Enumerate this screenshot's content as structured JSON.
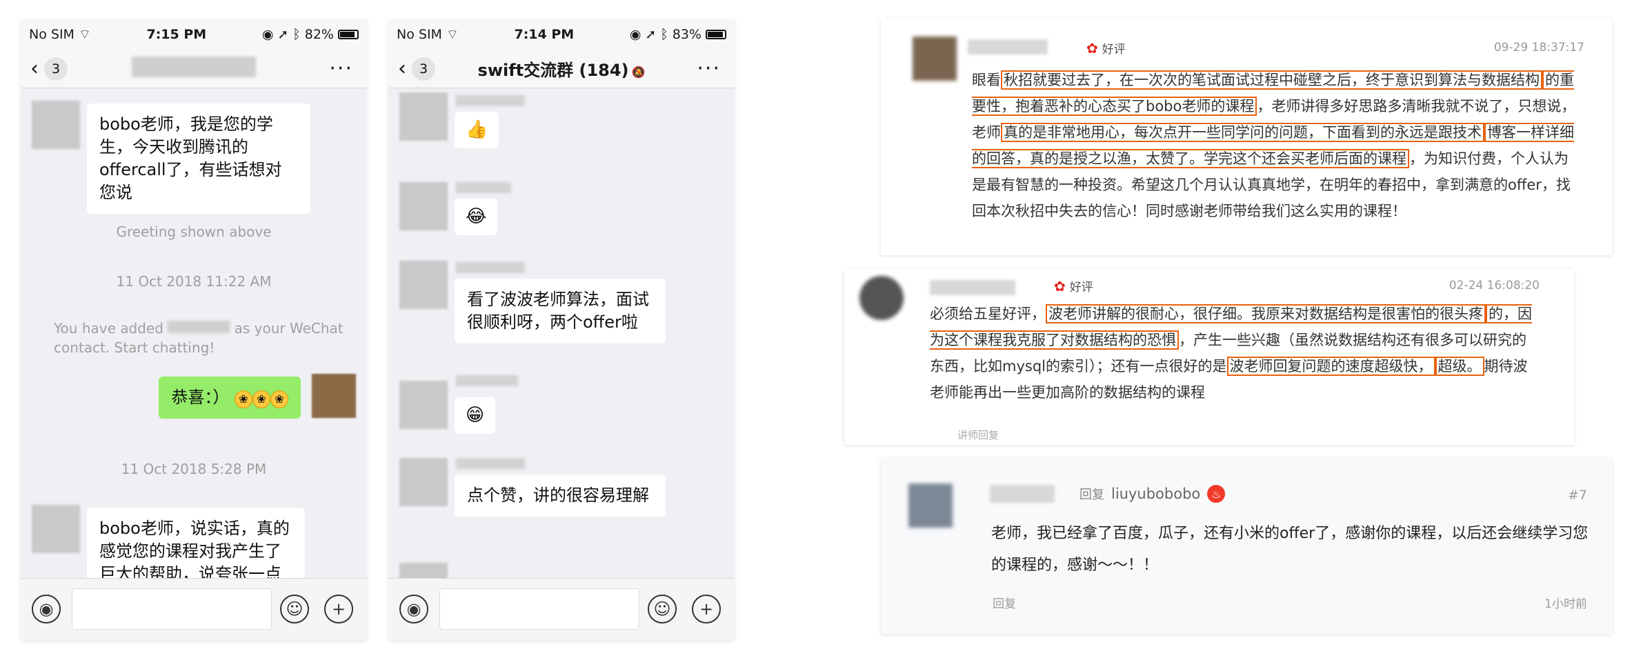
{
  "phone1": {
    "status": {
      "carrier": "No SIM",
      "time": "7:15 PM",
      "battery": "82%",
      "battery_level": 0.82
    },
    "nav": {
      "back_count": "3",
      "more": "···"
    },
    "messages": {
      "m1": "bobo老师，我是您的学生，今天收到腾讯的offercall了，有些话想对您说",
      "greeting": "Greeting shown above",
      "ts1": "11 Oct 2018 11:22 AM",
      "added_a": "You have added",
      "added_b": "as your WeChat contact. Start chatting!",
      "m2": "恭喜：）",
      "ts2": "11 Oct 2018 5:28 PM",
      "m3": "bobo老师，说实话，真的感觉您的课程对我产生了巨大的帮助，说夸张一点可以说是改变了"
    }
  },
  "phone2": {
    "status": {
      "carrier": "No SIM",
      "time": "7:14 PM",
      "battery": "83%",
      "battery_level": 0.83
    },
    "nav": {
      "back_count": "3",
      "title": "swift交流群 (184)",
      "more": "···"
    },
    "messages": {
      "m1": "👍",
      "m2": "😂",
      "m3": "看了波波老师算法，面试很顺利呀，两个offer啦",
      "m4": "😁",
      "m5": "点个赞，讲的很容易理解"
    }
  },
  "review1": {
    "badge": "好评",
    "date": "09-29 18:37:17",
    "p1": "眼看",
    "h1": "秋招就要过去了，在一次次的笔试面试过程中碰壁之后，终于意识到算法与数据结构",
    "h2": "的重要性，抱着恶补的心态买了bobo老师的课程",
    "p2": "，老师讲得多好思路多清晰我就不说了，只想说，老师",
    "h3": "真的是非常地用心，每次点开一些同学问的问题，下面看到的永远是跟技术",
    "h4": "博客一样详细的回答，真的是授之以渔，太赞了。学完这个还会买老师后面的课程",
    "p3": "，为知识付费，个人认为是最有智慧的一种投资。希望这几个月认认真真地学，在明年的春招中，拿到满意的offer，找回本次秋招中失去的信心！同时感谢老师带给我们这么实用的课程！"
  },
  "review2": {
    "badge": "好评",
    "date": "02-24 16:08:20",
    "p1": "必须给五星好评，",
    "h1": "波老师讲解的很耐心，很仔细。我原来对数据结构是很害怕的很头疼",
    "h2": "的，因为这个课程我克服了对数据结构的恐惧",
    "p2": "，产生一些兴趣（虽然说数据结构还有很多可以研究的东西，比如mysql的索引）；还有一点很好的是",
    "h3": "波老师回复问题的速度超级快，",
    "h4": "超级。",
    "p3": "期待波老师能再出一些更加高阶的数据结构的课程",
    "reply": "讲师回复"
  },
  "review3": {
    "reply_label": "回复",
    "author": "liuyubobobo",
    "floor": "#7",
    "text": "老师，我已经拿了百度，瓜子，还有小米的offer了，感谢你的课程，以后还会继续学习您的课程的，感谢～～！！",
    "reply": "回复",
    "time": "1小时前"
  }
}
